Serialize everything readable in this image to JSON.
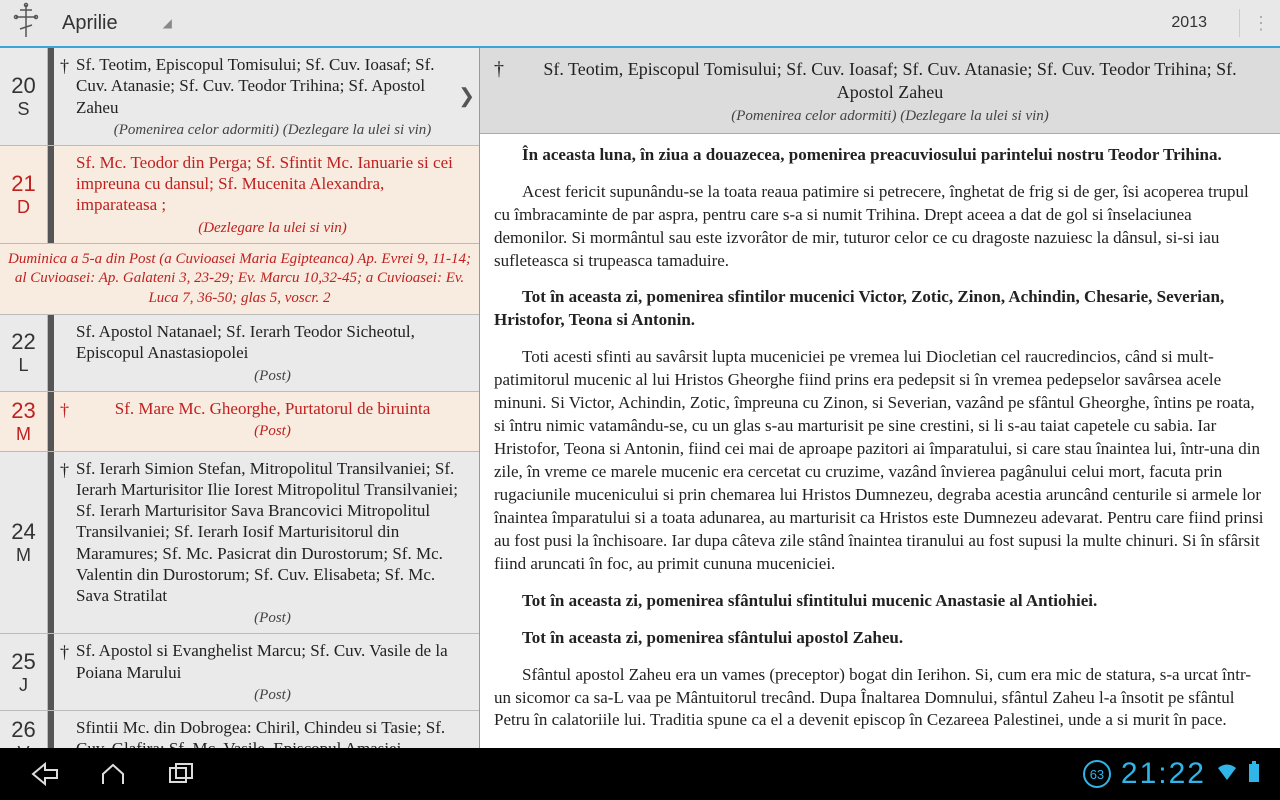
{
  "header": {
    "month": "Aprilie",
    "year": "2013"
  },
  "days": [
    {
      "num": "20",
      "dow": "S",
      "red": false,
      "highlight": false,
      "cross": "†",
      "crossRed": false,
      "saints": "Sf. Teotim, Episcopul Tomisului; Sf. Cuv. Ioasaf; Sf. Cuv. Atanasie; Sf. Cuv. Teodor Trihina; Sf. Apostol Zaheu",
      "saintsRed": false,
      "note": "(Pomenirea celor adormiti) (Dezlegare la ulei si vin)",
      "noteRed": false,
      "chevron": true
    },
    {
      "num": "21",
      "dow": "D",
      "red": true,
      "highlight": true,
      "cross": "",
      "crossRed": false,
      "saints": "Sf. Mc. Teodor din Perga; Sf. Sfintit Mc. Ianuarie si cei impreuna cu dansul; Sf. Mucenita Alexandra, imparateasa ;",
      "saintsRed": true,
      "note": "(Dezlegare la ulei si vin)",
      "noteRed": true,
      "chevron": false
    },
    {
      "interstitial": "Duminica a 5-a din Post (a Cuvioasei Maria Egipteanca) Ap. Evrei 9, 11-14; al Cuvioasei: Ap. Galateni 3, 23-29; Ev. Marcu 10,32-45; a Cuvioasei: Ev. Luca 7, 36-50; glas 5, voscr. 2"
    },
    {
      "num": "22",
      "dow": "L",
      "red": false,
      "highlight": false,
      "cross": "",
      "crossRed": false,
      "saints": "Sf. Apostol Natanael; Sf. Ierarh Teodor Sicheotul, Episcopul Anastasiopolei",
      "saintsRed": false,
      "note": "(Post)",
      "noteRed": false,
      "chevron": false
    },
    {
      "num": "23",
      "dow": "M",
      "red": true,
      "highlight": true,
      "cross": "†",
      "crossRed": true,
      "saints": "Sf. Mare Mc. Gheorghe, Purtatorul de biruinta",
      "saintsRed": true,
      "note": "(Post)",
      "noteRed": true,
      "chevron": false,
      "centerSaints": true
    },
    {
      "num": "24",
      "dow": "M",
      "red": false,
      "highlight": false,
      "cross": "†",
      "crossRed": false,
      "saints": "Sf. Ierarh Simion Stefan, Mitropolitul Transilvaniei;  Sf. Ierarh Marturisitor Ilie Iorest Mitropolitul Transilvaniei; Sf. Ierarh Marturisitor Sava Brancovici Mitropolitul Transilvaniei; Sf. Ierarh Iosif Marturisitorul din Maramures; Sf. Mc. Pasicrat din Durostorum; Sf. Mc. Valentin din Durostorum; Sf. Cuv. Elisabeta; Sf. Mc. Sava Stratilat",
      "saintsRed": false,
      "note": "(Post)",
      "noteRed": false,
      "chevron": false
    },
    {
      "num": "25",
      "dow": "J",
      "red": false,
      "highlight": false,
      "cross": "†",
      "crossRed": false,
      "saints": "Sf. Apostol si Evanghelist Marcu; Sf. Cuv. Vasile de la Poiana Marului",
      "saintsRed": false,
      "note": "(Post)",
      "noteRed": false,
      "chevron": false
    },
    {
      "num": "26",
      "dow": "V",
      "red": false,
      "highlight": false,
      "cross": "",
      "crossRed": false,
      "saints": "Sfintii Mc. din Dobrogea: Chiril, Chindeu si Tasie; Sf. Cuv. Glafira; Sf. Mc. Vasile, Episcopul Amasiei",
      "saintsRed": false,
      "note": "",
      "noteRed": false,
      "chevron": false,
      "last": true
    }
  ],
  "detail": {
    "cross": "†",
    "saints": "Sf. Teotim, Episcopul Tomisului; Sf. Cuv. Ioasaf; Sf. Cuv. Atanasie; Sf. Cuv. Teodor Trihina; Sf. Apostol Zaheu",
    "note": "(Pomenirea celor adormiti) (Dezlegare la ulei si vin)",
    "paragraphs": [
      {
        "lead": "În aceasta luna, în ziua a douazecea, pomenirea preacuviosului parintelui nostru Teodor Trihina.",
        "rest": ""
      },
      {
        "lead": "",
        "rest": "Acest fericit supunându-se la toata reaua patimire si petrecere, înghetat de frig si de ger, îsi acoperea trupul cu îmbracaminte de par aspra, pentru care s-a si numit Trihina. Drept aceea a dat de gol si înselaciunea demonilor. Si mormântul sau este izvorâtor de mir, tuturor celor ce cu dragoste nazuiesc la dânsul, si-si iau sufleteasca si trupeasca tamaduire."
      },
      {
        "lead": "Tot în aceasta zi, pomenirea sfintilor mucenici Victor, Zotic, Zinon, Achindin, Chesarie, Severian, Hristofor, Teona si Antonin.",
        "rest": ""
      },
      {
        "lead": "",
        "rest": "Toti acesti sfinti au savârsit lupta muceniciei pe vremea lui Diocletian cel raucredincios, când si mult-patimitorul mucenic al lui Hristos Gheorghe fiind prins era pedepsit si în vremea pedepselor savârsea acele minuni. Si Victor, Achindin, Zotic, împreuna cu Zinon, si Severian, vazând pe sfântul Gheorghe, întins pe roata, si întru nimic vatamându-se, cu un glas s-au marturisit pe sine crestini, si li s-au taiat capetele cu sabia. Iar Hristofor, Teona si Antonin, fiind cei mai de aproape pazitori ai împaratului, si care stau înaintea lui, într-una din zile, în vreme ce marele mucenic era cercetat cu cruzime, vazând învierea pagânului celui mort, facuta prin rugaciunile mucenicului si prin chemarea lui Hristos Dumnezeu, degraba acestia aruncând centurile si armele lor înaintea împaratului si a toata adunarea, au marturisit ca Hristos este Dumnezeu adevarat. Pentru care fiind prinsi au fost pusi la închisoare. Iar dupa câteva zile stând înaintea tiranului au fost supusi la multe chinuri. Si în sfârsit fiind aruncati în foc, au primit cununa muceniciei."
      },
      {
        "lead": "Tot în aceasta zi, pomenirea sfântului sfintitului mucenic Anastasie al Antiohiei.",
        "rest": ""
      },
      {
        "lead": "Tot în aceasta zi, pomenirea sfântului apostol Zaheu.",
        "rest": ""
      },
      {
        "lead": "",
        "rest": "Sfântul apostol Zaheu era un vames (preceptor) bogat din Ierihon. Si, cum era mic de statura, s-a urcat într-un sicomor ca sa-L vaa pe Mântuitorul trecând. Dupa Înaltarea Domnului, sfântul Zaheu l-a însotit pe sfântul Petru în calatoriile lui. Traditia spune ca el a devenit episcop în Cezareea Palestinei, unde a si murit în pace."
      }
    ]
  },
  "navbar": {
    "battery": "63",
    "clock": "21:22"
  }
}
